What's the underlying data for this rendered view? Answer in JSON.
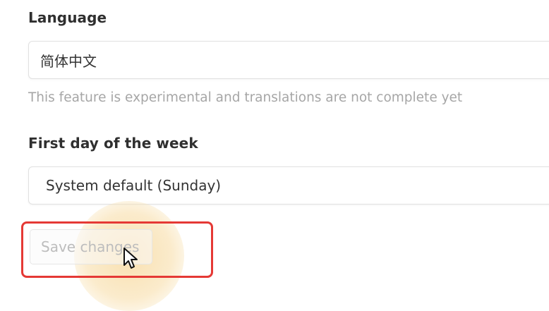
{
  "language": {
    "label": "Language",
    "selected": "简体中文",
    "help_text": "This feature is experimental and translations are not complete yet"
  },
  "first_day": {
    "label": "First day of the week",
    "selected": "System default (Sunday)"
  },
  "actions": {
    "save_label": "Save changes"
  },
  "annotation": {
    "highlight_color": "#e53935",
    "glow_color": "#f7d696"
  },
  "icons": {
    "cursor": "mouse-pointer-icon"
  }
}
